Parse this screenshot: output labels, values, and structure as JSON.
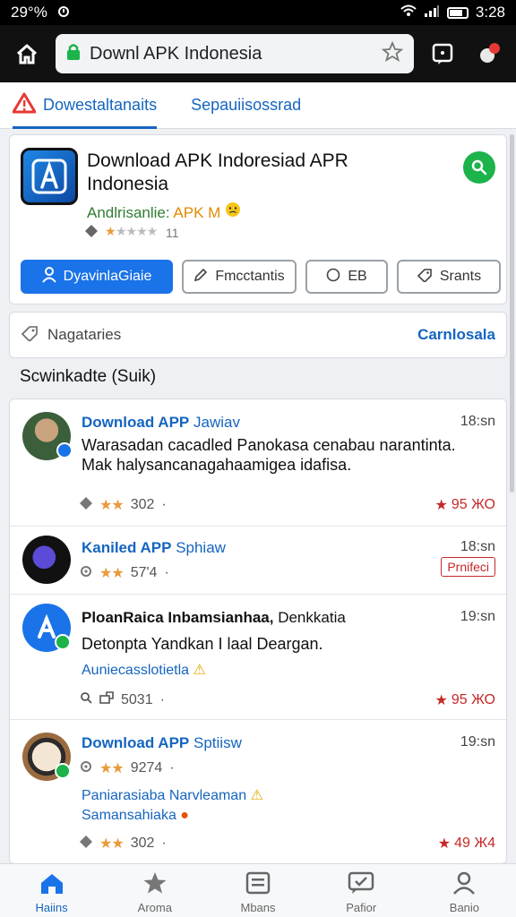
{
  "status": {
    "left_text": "29°%",
    "time": "3:28"
  },
  "browser": {
    "url": "Downl APK Indonesia"
  },
  "tabs": [
    {
      "label": "Dowestaltanaits"
    },
    {
      "label": "Sepauiisossrad"
    }
  ],
  "app": {
    "title": "Download APK Indoresiad APR Indonesia",
    "developer": "Andlrisanlie:",
    "developer_sub": "APK M",
    "rating_text": "11",
    "buttons": {
      "primary": "DyavinlaGiaie",
      "b2": "Fmcctantis",
      "b3": "EB",
      "b4": "Srants"
    }
  },
  "nav": {
    "label": "Nagataries",
    "link": "Carnlosala"
  },
  "section_title": "Scwinkadte (Suik)",
  "feed": [
    {
      "title_bold": "Download APP",
      "title_sub": "Jawiav",
      "time": "18:sn",
      "body": "Warasadan cacadled Panokasa cenabau narantinta. Mak halysancanagahaamigea idafisa.",
      "count": "302",
      "stat": "95 ЖО"
    },
    {
      "title_bold": "Kaniled APP",
      "title_sub": "Sphiaw",
      "time": "18:sn",
      "count": "57'4",
      "tag": "Prnifeci"
    },
    {
      "title_bold": "PloanRaica Inbamsianhaa,",
      "title_sub": "Denkkatia",
      "time": "19:sn",
      "body": "Detonpta Yandkan I laal Deargan.",
      "sub": "Auniecasslotietla",
      "count": "5031",
      "stat": "95 ЖО"
    },
    {
      "title_bold": "Download APP",
      "title_sub": "Sptiisw",
      "time": "19:sn",
      "count": "9274",
      "sub": "Paniarasiaba Narvleaman",
      "sub2": "Samansahiaka",
      "count2": "302",
      "stat": "49 Ж4"
    }
  ],
  "bottom_nav": [
    {
      "label": "Haiins"
    },
    {
      "label": "Aroma"
    },
    {
      "label": "Mbans"
    },
    {
      "label": "Pafior"
    },
    {
      "label": "Banio"
    }
  ]
}
